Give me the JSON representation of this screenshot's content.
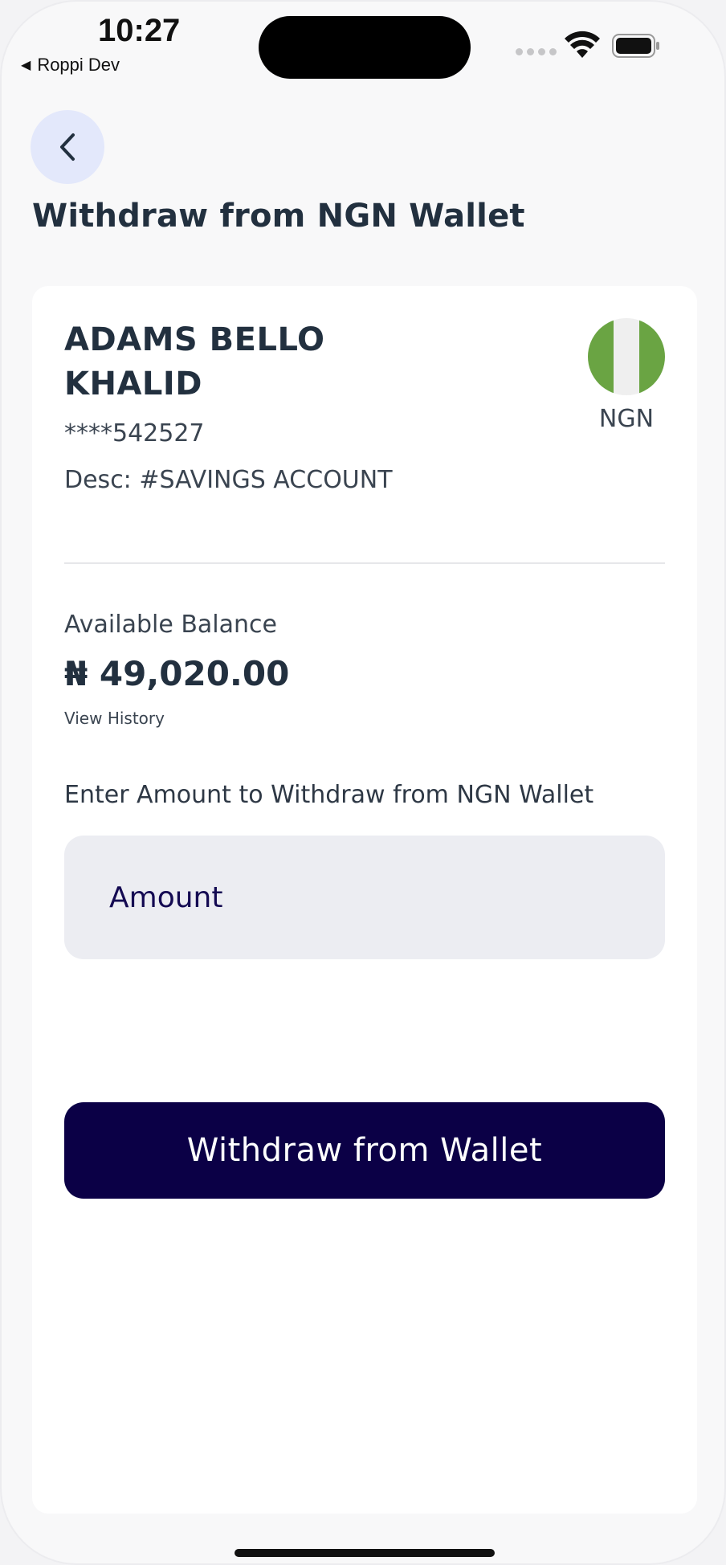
{
  "status_bar": {
    "time": "10:27",
    "back_app": "Roppi Dev",
    "back_arrow": "◀"
  },
  "header": {
    "back_icon": "chevron-left-icon",
    "title": "Withdraw from NGN Wallet"
  },
  "account": {
    "name": "ADAMS BELLO KHALID",
    "number": "****542527",
    "description": "Desc: #SAVINGS ACCOUNT",
    "currency": "NGN",
    "flag_icon": "nigeria-flag-icon",
    "flag_colors": [
      "#6aa443",
      "#efefef",
      "#6aa443"
    ]
  },
  "balance": {
    "label": "Available Balance",
    "value": "₦ 49,020.00",
    "history_link": "View History"
  },
  "withdraw": {
    "prompt": "Enter Amount to Withdraw from NGN Wallet",
    "amount_placeholder": "Amount",
    "amount_value": "",
    "button_label": "Withdraw from Wallet"
  },
  "colors": {
    "primary": "#0b0046",
    "back_button_bg": "#e3e8fb",
    "input_bg": "#ecedf2",
    "text_dark": "#22303f"
  }
}
